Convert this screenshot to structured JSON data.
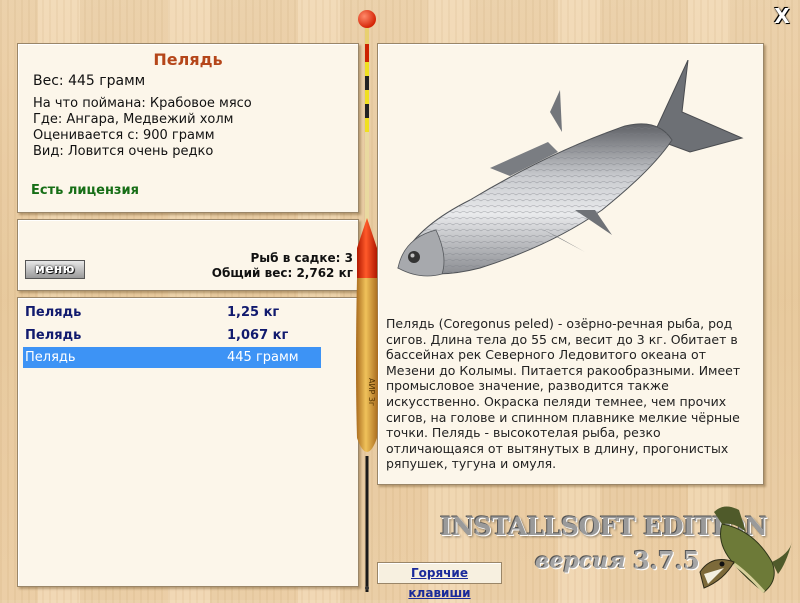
{
  "fish": {
    "name": "Пелядь",
    "weight_line": "Вес: 445 грамм",
    "bait_line": "На что поймана: Крабовое мясо",
    "place_line": "Где: Ангара, Медвежий холм",
    "value_line": "Оценивается с: 900 грамм",
    "kind_line": "Вид: Ловится очень редко",
    "license": "Есть лицензия"
  },
  "summary": {
    "menu_label": "меню",
    "count_line": "Рыб в садке: 3",
    "total_line": "Общий вес: 2,762 кг"
  },
  "catch_list": [
    {
      "name": "Пелядь",
      "weight": "1,25 кг"
    },
    {
      "name": "Пелядь",
      "weight": "1,067 кг"
    },
    {
      "name": "Пелядь",
      "weight": "445 грамм"
    }
  ],
  "description": "Пелядь (Coregonus peled) - озёрно-речная рыба, род сигов. Длина тела до 55 см, весит до 3 кг. Обитает в бассейнах рек Северного Ледовитого океана от Мезени до Колымы. Питается ракообразными. Имеет промысловое значение, разводится также искусственно. Окраска пеляди темнее, чем прочих сигов, на голове и спинном плавнике мелкие чёрные точки. Пелядь - высокотелая рыба, резко отличающаяся от вытянутых в длину, прогонистых ряпушек, тугуна и омуля.",
  "branding": {
    "edition": "INSTALLSOFT EDITION",
    "version_label": "версия",
    "version_number": "3.7.5",
    "float_marking": "АИР 3г"
  },
  "hotkeys_label": "Горячие клавиши",
  "close_symbol": "X",
  "icons": {
    "close": "close-icon",
    "float": "fishing-float-icon",
    "logo": "pike-logo-icon"
  },
  "colors": {
    "fish_name": "#b5461a",
    "license": "#166e16",
    "list_bold": "#111a6e",
    "selection": "#3d93f5",
    "hotkeys": "#1a2a9a"
  }
}
